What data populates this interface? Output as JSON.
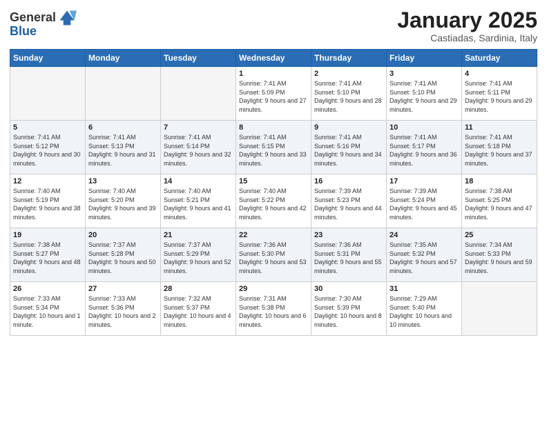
{
  "logo": {
    "general": "General",
    "blue": "Blue"
  },
  "header": {
    "month": "January 2025",
    "location": "Castiadas, Sardinia, Italy"
  },
  "weekdays": [
    "Sunday",
    "Monday",
    "Tuesday",
    "Wednesday",
    "Thursday",
    "Friday",
    "Saturday"
  ],
  "weeks": [
    [
      {
        "day": "",
        "info": ""
      },
      {
        "day": "",
        "info": ""
      },
      {
        "day": "",
        "info": ""
      },
      {
        "day": "1",
        "info": "Sunrise: 7:41 AM\nSunset: 5:09 PM\nDaylight: 9 hours and 27 minutes."
      },
      {
        "day": "2",
        "info": "Sunrise: 7:41 AM\nSunset: 5:10 PM\nDaylight: 9 hours and 28 minutes."
      },
      {
        "day": "3",
        "info": "Sunrise: 7:41 AM\nSunset: 5:10 PM\nDaylight: 9 hours and 29 minutes."
      },
      {
        "day": "4",
        "info": "Sunrise: 7:41 AM\nSunset: 5:11 PM\nDaylight: 9 hours and 29 minutes."
      }
    ],
    [
      {
        "day": "5",
        "info": "Sunrise: 7:41 AM\nSunset: 5:12 PM\nDaylight: 9 hours and 30 minutes."
      },
      {
        "day": "6",
        "info": "Sunrise: 7:41 AM\nSunset: 5:13 PM\nDaylight: 9 hours and 31 minutes."
      },
      {
        "day": "7",
        "info": "Sunrise: 7:41 AM\nSunset: 5:14 PM\nDaylight: 9 hours and 32 minutes."
      },
      {
        "day": "8",
        "info": "Sunrise: 7:41 AM\nSunset: 5:15 PM\nDaylight: 9 hours and 33 minutes."
      },
      {
        "day": "9",
        "info": "Sunrise: 7:41 AM\nSunset: 5:16 PM\nDaylight: 9 hours and 34 minutes."
      },
      {
        "day": "10",
        "info": "Sunrise: 7:41 AM\nSunset: 5:17 PM\nDaylight: 9 hours and 36 minutes."
      },
      {
        "day": "11",
        "info": "Sunrise: 7:41 AM\nSunset: 5:18 PM\nDaylight: 9 hours and 37 minutes."
      }
    ],
    [
      {
        "day": "12",
        "info": "Sunrise: 7:40 AM\nSunset: 5:19 PM\nDaylight: 9 hours and 38 minutes."
      },
      {
        "day": "13",
        "info": "Sunrise: 7:40 AM\nSunset: 5:20 PM\nDaylight: 9 hours and 39 minutes."
      },
      {
        "day": "14",
        "info": "Sunrise: 7:40 AM\nSunset: 5:21 PM\nDaylight: 9 hours and 41 minutes."
      },
      {
        "day": "15",
        "info": "Sunrise: 7:40 AM\nSunset: 5:22 PM\nDaylight: 9 hours and 42 minutes."
      },
      {
        "day": "16",
        "info": "Sunrise: 7:39 AM\nSunset: 5:23 PM\nDaylight: 9 hours and 44 minutes."
      },
      {
        "day": "17",
        "info": "Sunrise: 7:39 AM\nSunset: 5:24 PM\nDaylight: 9 hours and 45 minutes."
      },
      {
        "day": "18",
        "info": "Sunrise: 7:38 AM\nSunset: 5:25 PM\nDaylight: 9 hours and 47 minutes."
      }
    ],
    [
      {
        "day": "19",
        "info": "Sunrise: 7:38 AM\nSunset: 5:27 PM\nDaylight: 9 hours and 48 minutes."
      },
      {
        "day": "20",
        "info": "Sunrise: 7:37 AM\nSunset: 5:28 PM\nDaylight: 9 hours and 50 minutes."
      },
      {
        "day": "21",
        "info": "Sunrise: 7:37 AM\nSunset: 5:29 PM\nDaylight: 9 hours and 52 minutes."
      },
      {
        "day": "22",
        "info": "Sunrise: 7:36 AM\nSunset: 5:30 PM\nDaylight: 9 hours and 53 minutes."
      },
      {
        "day": "23",
        "info": "Sunrise: 7:36 AM\nSunset: 5:31 PM\nDaylight: 9 hours and 55 minutes."
      },
      {
        "day": "24",
        "info": "Sunrise: 7:35 AM\nSunset: 5:32 PM\nDaylight: 9 hours and 57 minutes."
      },
      {
        "day": "25",
        "info": "Sunrise: 7:34 AM\nSunset: 5:33 PM\nDaylight: 9 hours and 59 minutes."
      }
    ],
    [
      {
        "day": "26",
        "info": "Sunrise: 7:33 AM\nSunset: 5:34 PM\nDaylight: 10 hours and 1 minute."
      },
      {
        "day": "27",
        "info": "Sunrise: 7:33 AM\nSunset: 5:36 PM\nDaylight: 10 hours and 2 minutes."
      },
      {
        "day": "28",
        "info": "Sunrise: 7:32 AM\nSunset: 5:37 PM\nDaylight: 10 hours and 4 minutes."
      },
      {
        "day": "29",
        "info": "Sunrise: 7:31 AM\nSunset: 5:38 PM\nDaylight: 10 hours and 6 minutes."
      },
      {
        "day": "30",
        "info": "Sunrise: 7:30 AM\nSunset: 5:39 PM\nDaylight: 10 hours and 8 minutes."
      },
      {
        "day": "31",
        "info": "Sunrise: 7:29 AM\nSunset: 5:40 PM\nDaylight: 10 hours and 10 minutes."
      },
      {
        "day": "",
        "info": ""
      }
    ]
  ]
}
